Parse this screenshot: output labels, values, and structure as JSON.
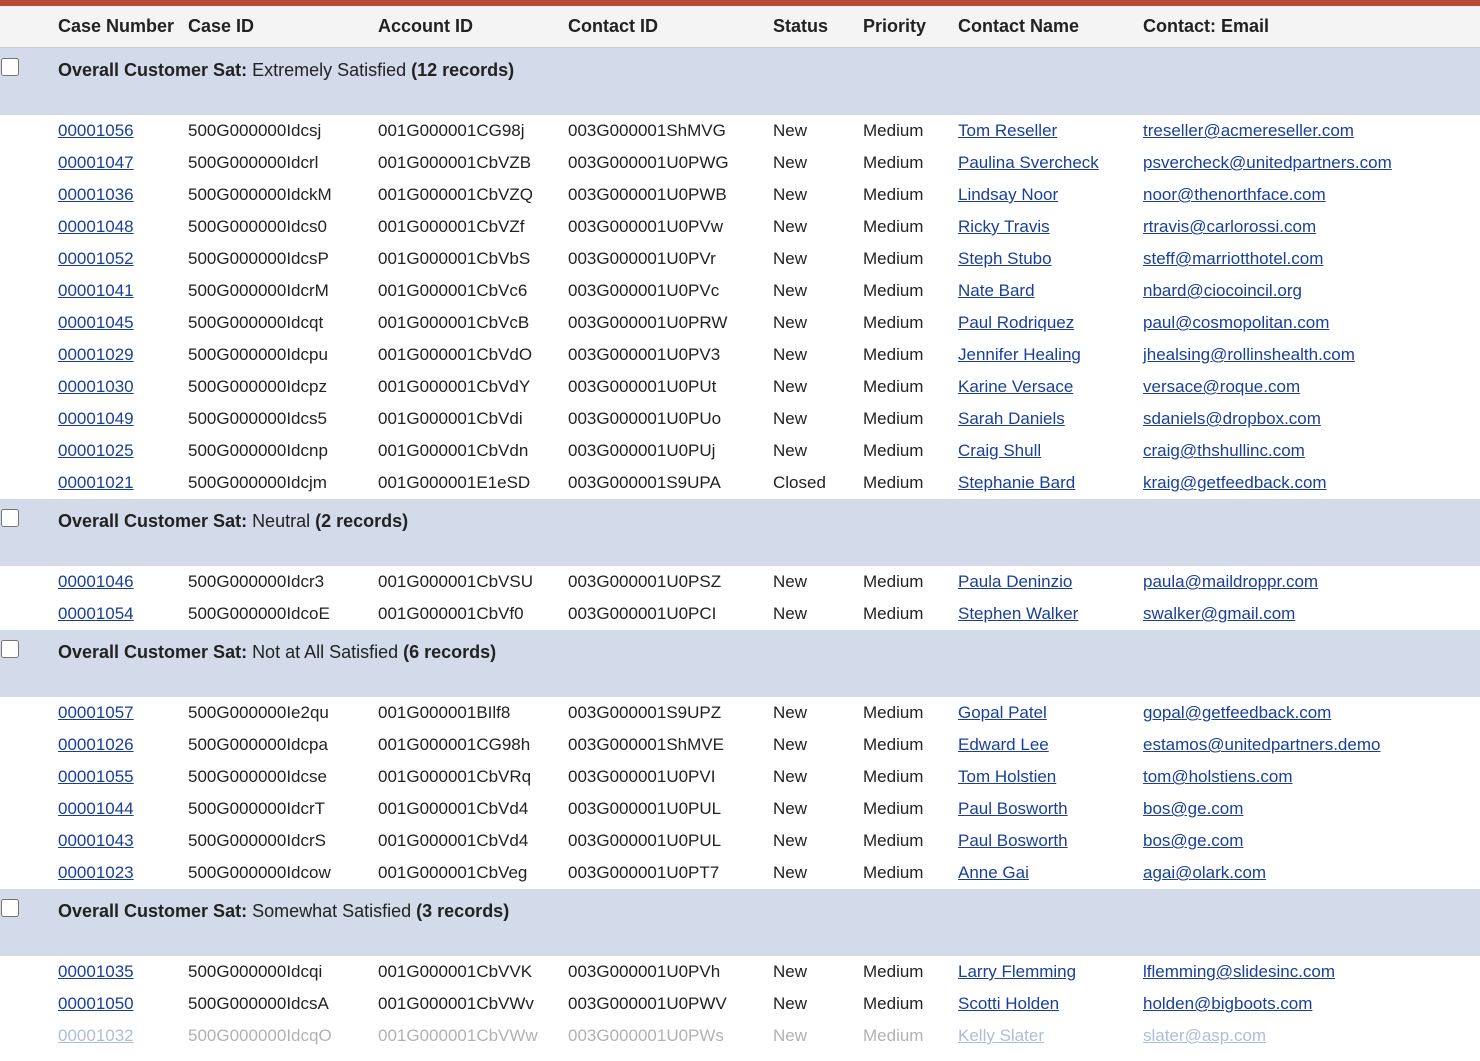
{
  "columns": {
    "checkbox": "",
    "case_number": "Case Number",
    "case_id": "Case ID",
    "account_id": "Account ID",
    "contact_id": "Contact ID",
    "status": "Status",
    "priority": "Priority",
    "contact_name": "Contact Name",
    "contact_email": "Contact: Email"
  },
  "group_field_label": "Overall Customer Sat",
  "groups": [
    {
      "level": "Extremely Satisfied",
      "count_label": "(12 records)",
      "rows": [
        {
          "case_number": "00001056",
          "case_id": "500G000000Idcsj",
          "account_id": "001G000001CG98j",
          "contact_id": "003G000001ShMVG",
          "status": "New",
          "priority": "Medium",
          "contact_name": "Tom Reseller",
          "contact_email": "treseller@acmereseller.com"
        },
        {
          "case_number": "00001047",
          "case_id": "500G000000Idcrl",
          "account_id": "001G000001CbVZB",
          "contact_id": "003G000001U0PWG",
          "status": "New",
          "priority": "Medium",
          "contact_name": "Paulina Svercheck",
          "contact_email": "psvercheck@unitedpartners.com"
        },
        {
          "case_number": "00001036",
          "case_id": "500G000000IdckM",
          "account_id": "001G000001CbVZQ",
          "contact_id": "003G000001U0PWB",
          "status": "New",
          "priority": "Medium",
          "contact_name": "Lindsay Noor",
          "contact_email": "noor@thenorthface.com"
        },
        {
          "case_number": "00001048",
          "case_id": "500G000000Idcs0",
          "account_id": "001G000001CbVZf",
          "contact_id": "003G000001U0PVw",
          "status": "New",
          "priority": "Medium",
          "contact_name": "Ricky Travis",
          "contact_email": "rtravis@carlorossi.com"
        },
        {
          "case_number": "00001052",
          "case_id": "500G000000IdcsP",
          "account_id": "001G000001CbVbS",
          "contact_id": "003G000001U0PVr",
          "status": "New",
          "priority": "Medium",
          "contact_name": "Steph Stubo",
          "contact_email": "steff@marriotthotel.com"
        },
        {
          "case_number": "00001041",
          "case_id": "500G000000IdcrM",
          "account_id": "001G000001CbVc6",
          "contact_id": "003G000001U0PVc",
          "status": "New",
          "priority": "Medium",
          "contact_name": "Nate Bard",
          "contact_email": "nbard@ciocoincil.org"
        },
        {
          "case_number": "00001045",
          "case_id": "500G000000Idcqt",
          "account_id": "001G000001CbVcB",
          "contact_id": "003G000001U0PRW",
          "status": "New",
          "priority": "Medium",
          "contact_name": "Paul Rodriquez",
          "contact_email": "paul@cosmopolitan.com"
        },
        {
          "case_number": "00001029",
          "case_id": "500G000000Idcpu",
          "account_id": "001G000001CbVdO",
          "contact_id": "003G000001U0PV3",
          "status": "New",
          "priority": "Medium",
          "contact_name": "Jennifer Healing",
          "contact_email": "jhealsing@rollinshealth.com"
        },
        {
          "case_number": "00001030",
          "case_id": "500G000000Idcpz",
          "account_id": "001G000001CbVdY",
          "contact_id": "003G000001U0PUt",
          "status": "New",
          "priority": "Medium",
          "contact_name": "Karine Versace",
          "contact_email": "versace@roque.com"
        },
        {
          "case_number": "00001049",
          "case_id": "500G000000Idcs5",
          "account_id": "001G000001CbVdi",
          "contact_id": "003G000001U0PUo",
          "status": "New",
          "priority": "Medium",
          "contact_name": "Sarah Daniels",
          "contact_email": "sdaniels@dropbox.com"
        },
        {
          "case_number": "00001025",
          "case_id": "500G000000Idcnp",
          "account_id": "001G000001CbVdn",
          "contact_id": "003G000001U0PUj",
          "status": "New",
          "priority": "Medium",
          "contact_name": "Craig Shull",
          "contact_email": "craig@thshullinc.com"
        },
        {
          "case_number": "00001021",
          "case_id": "500G000000Idcjm",
          "account_id": "001G000001E1eSD",
          "contact_id": "003G000001S9UPA",
          "status": "Closed",
          "priority": "Medium",
          "contact_name": "Stephanie Bard",
          "contact_email": "kraig@getfeedback.com"
        }
      ]
    },
    {
      "level": "Neutral",
      "count_label": "(2 records)",
      "rows": [
        {
          "case_number": "00001046",
          "case_id": "500G000000Idcr3",
          "account_id": "001G000001CbVSU",
          "contact_id": "003G000001U0PSZ",
          "status": "New",
          "priority": "Medium",
          "contact_name": "Paula Deninzio",
          "contact_email": "paula@maildroppr.com"
        },
        {
          "case_number": "00001054",
          "case_id": "500G000000IdcoE",
          "account_id": "001G000001CbVf0",
          "contact_id": "003G000001U0PCI",
          "status": "New",
          "priority": "Medium",
          "contact_name": "Stephen Walker",
          "contact_email": "swalker@gmail.com"
        }
      ]
    },
    {
      "level": "Not at All Satisfied",
      "count_label": "(6 records)",
      "rows": [
        {
          "case_number": "00001057",
          "case_id": "500G000000Ie2qu",
          "account_id": "001G000001BIlf8",
          "contact_id": "003G000001S9UPZ",
          "status": "New",
          "priority": "Medium",
          "contact_name": "Gopal Patel",
          "contact_email": "gopal@getfeedback.com"
        },
        {
          "case_number": "00001026",
          "case_id": "500G000000Idcpa",
          "account_id": "001G000001CG98h",
          "contact_id": "003G000001ShMVE",
          "status": "New",
          "priority": "Medium",
          "contact_name": "Edward Lee",
          "contact_email": "estamos@unitedpartners.demo"
        },
        {
          "case_number": "00001055",
          "case_id": "500G000000Idcse",
          "account_id": "001G000001CbVRq",
          "contact_id": "003G000001U0PVI",
          "status": "New",
          "priority": "Medium",
          "contact_name": "Tom Holstien",
          "contact_email": "tom@holstiens.com"
        },
        {
          "case_number": "00001044",
          "case_id": "500G000000IdcrT",
          "account_id": "001G000001CbVd4",
          "contact_id": "003G000001U0PUL",
          "status": "New",
          "priority": "Medium",
          "contact_name": "Paul Bosworth",
          "contact_email": "bos@ge.com"
        },
        {
          "case_number": "00001043",
          "case_id": "500G000000IdcrS",
          "account_id": "001G000001CbVd4",
          "contact_id": "003G000001U0PUL",
          "status": "New",
          "priority": "Medium",
          "contact_name": "Paul Bosworth",
          "contact_email": "bos@ge.com"
        },
        {
          "case_number": "00001023",
          "case_id": "500G000000Idcow",
          "account_id": "001G000001CbVeg",
          "contact_id": "003G000001U0PT7",
          "status": "New",
          "priority": "Medium",
          "contact_name": "Anne Gai",
          "contact_email": "agai@olark.com"
        }
      ]
    },
    {
      "level": "Somewhat Satisfied",
      "count_label": "(3 records)",
      "rows": [
        {
          "case_number": "00001035",
          "case_id": "500G000000Idcqi",
          "account_id": "001G000001CbVVK",
          "contact_id": "003G000001U0PVh",
          "status": "New",
          "priority": "Medium",
          "contact_name": "Larry Flemming",
          "contact_email": "lflemming@slidesinc.com"
        },
        {
          "case_number": "00001050",
          "case_id": "500G000000IdcsA",
          "account_id": "001G000001CbVWv",
          "contact_id": "003G000001U0PWV",
          "status": "New",
          "priority": "Medium",
          "contact_name": "Scotti Holden",
          "contact_email": "holden@bigboots.com"
        },
        {
          "case_number": "00001032",
          "case_id": "500G000000IdcqO",
          "account_id": "001G000001CbVWw",
          "contact_id": "003G000001U0PWs",
          "status": "New",
          "priority": "Medium",
          "contact_name": "Kelly Slater",
          "contact_email": "slater@asp.com",
          "faded": true
        }
      ]
    }
  ]
}
